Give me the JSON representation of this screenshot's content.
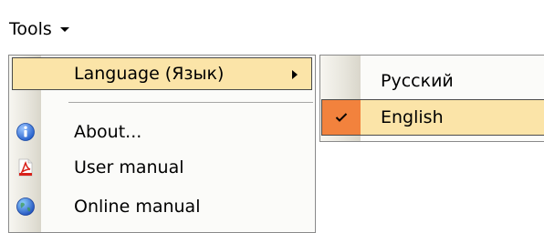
{
  "menubar": {
    "tools_label": "Tools"
  },
  "tools_menu": {
    "items": [
      {
        "label": "Language (Язык)",
        "icon": "none",
        "has_submenu": true,
        "highlighted": true
      },
      {
        "label": "About...",
        "icon": "info-icon"
      },
      {
        "label": "User manual",
        "icon": "pdf-icon"
      },
      {
        "label": "Online manual",
        "icon": "globe-icon"
      }
    ]
  },
  "language_submenu": {
    "items": [
      {
        "label": "Русский",
        "checked": false
      },
      {
        "label": "English",
        "checked": true,
        "highlighted": true
      }
    ]
  },
  "colors": {
    "highlight": "#fbe4a8",
    "check_background": "#f2823d",
    "menu_border": "#8a8a8a"
  }
}
